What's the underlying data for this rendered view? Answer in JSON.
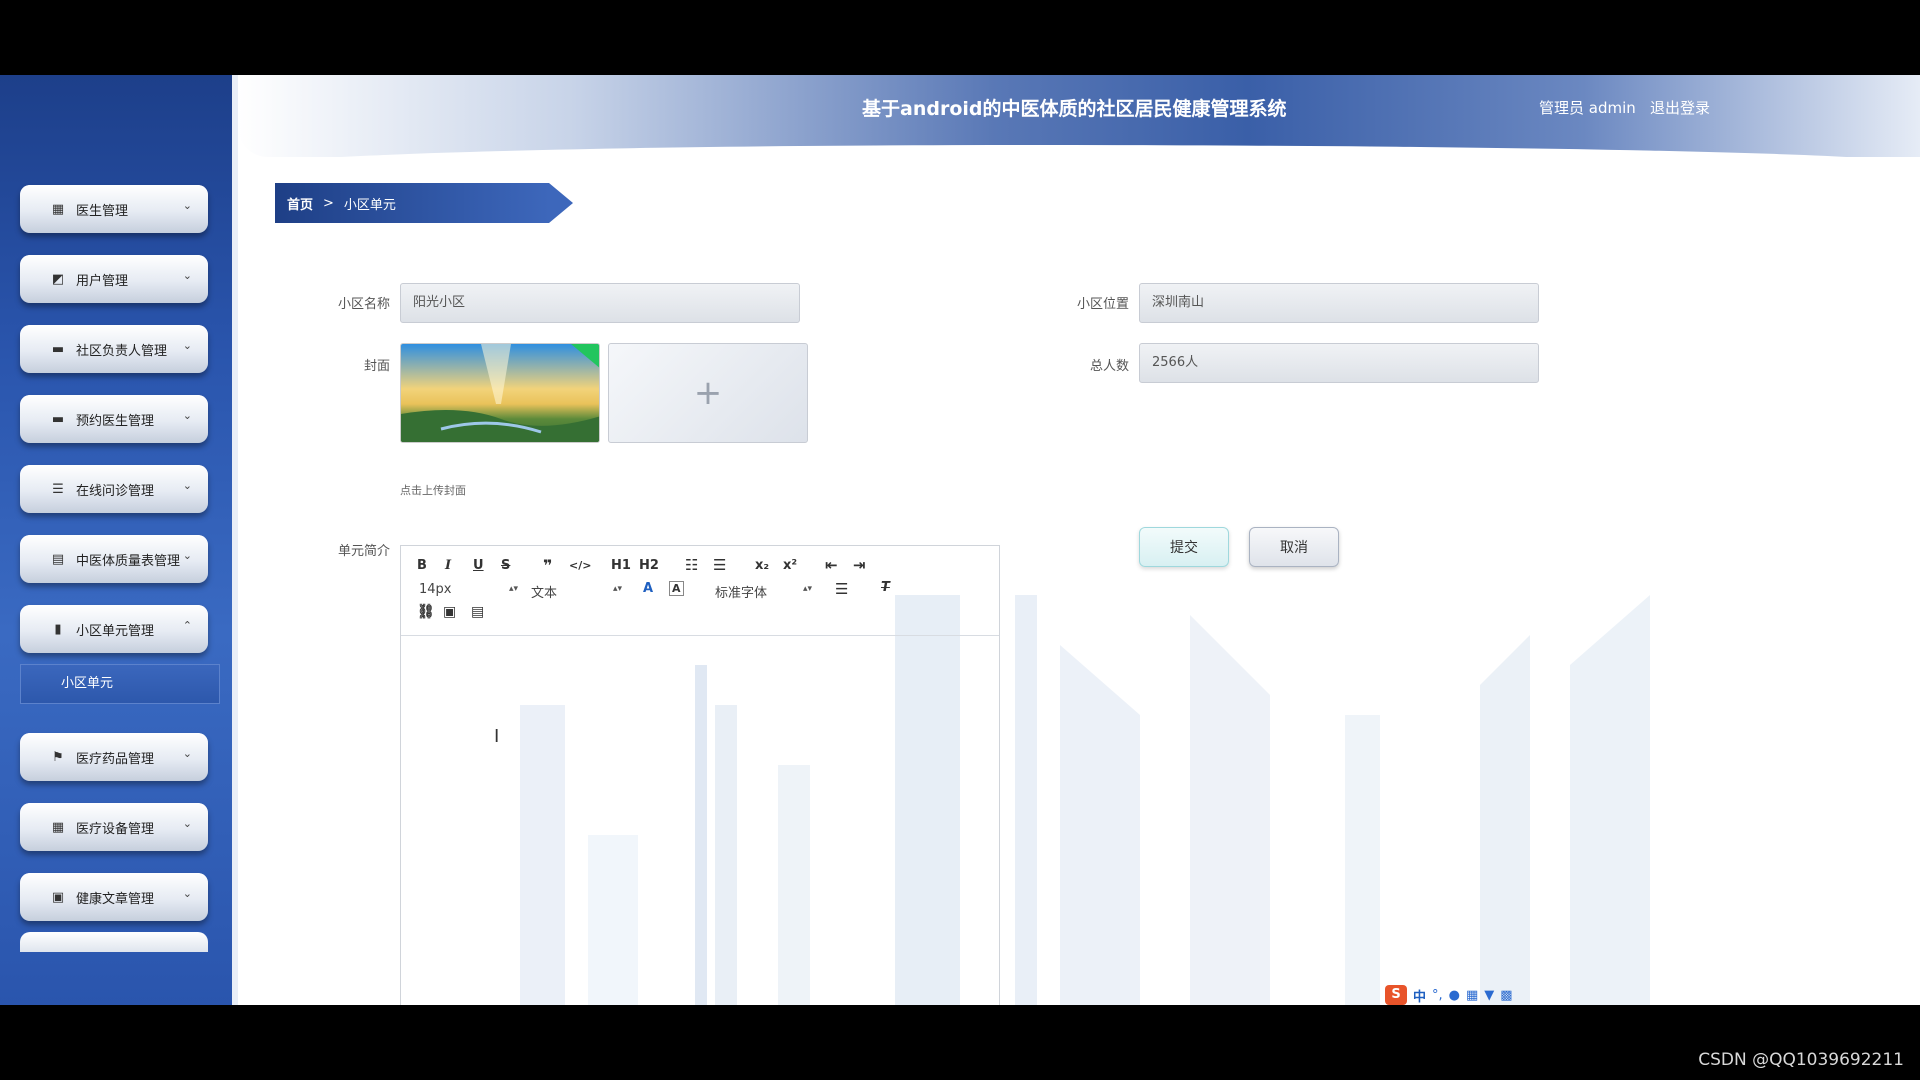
{
  "header": {
    "title": "基于android的中医体质的社区居民健康管理系统",
    "admin_label": "管理员 admin",
    "logout_label": "退出登录"
  },
  "sidebar": {
    "items": [
      {
        "label": "医生管理",
        "icon": "grid-icon",
        "chevron": "⌄"
      },
      {
        "label": "用户管理",
        "icon": "chart-icon",
        "chevron": "⌄"
      },
      {
        "label": "社区负责人管理",
        "icon": "briefcase-icon",
        "chevron": "⌄"
      },
      {
        "label": "预约医生管理",
        "icon": "message-icon",
        "chevron": "⌄"
      },
      {
        "label": "在线问诊管理",
        "icon": "sliders-icon",
        "chevron": "⌄"
      },
      {
        "label": "中医体质量表管理",
        "icon": "clipboard-icon",
        "chevron": "⌄"
      },
      {
        "label": "小区单元管理",
        "icon": "bar-chart-icon",
        "chevron": "⌃"
      },
      {
        "label": "医疗药品管理",
        "icon": "flag-icon",
        "chevron": "⌄"
      },
      {
        "label": "医疗设备管理",
        "icon": "grid-icon",
        "chevron": "⌄"
      },
      {
        "label": "健康文章管理",
        "icon": "trash-icon",
        "chevron": "⌄"
      }
    ],
    "active_subitem": "小区单元"
  },
  "breadcrumb": {
    "home": "首页",
    "separator": ">",
    "current": "小区单元"
  },
  "form": {
    "name_label": "小区名称",
    "name_value": "阳光小区",
    "location_label": "小区位置",
    "location_value": "深圳南山",
    "cover_label": "封面",
    "population_label": "总人数",
    "population_value": "2566人",
    "upload_plus": "+",
    "upload_hint": "点击上传封面",
    "intro_label": "单元简介"
  },
  "editor": {
    "font_size": "14px",
    "text_type": "文本",
    "font_family": "标准字体",
    "toolbar_buttons": [
      "B",
      "I",
      "U",
      "S",
      "❞",
      "</>",
      "H1",
      "H2",
      "ordered-list",
      "bullet-list",
      "x₂",
      "x²",
      "outdent",
      "indent"
    ]
  },
  "buttons": {
    "submit": "提交",
    "cancel": "取消"
  },
  "ime": {
    "zh": "中"
  },
  "watermark": "CSDN @QQ1039692211",
  "colors": {
    "sidebar": "#2a55ad",
    "header_accent": "#3a5fa8",
    "breadcrumb": "#1e3f86"
  }
}
